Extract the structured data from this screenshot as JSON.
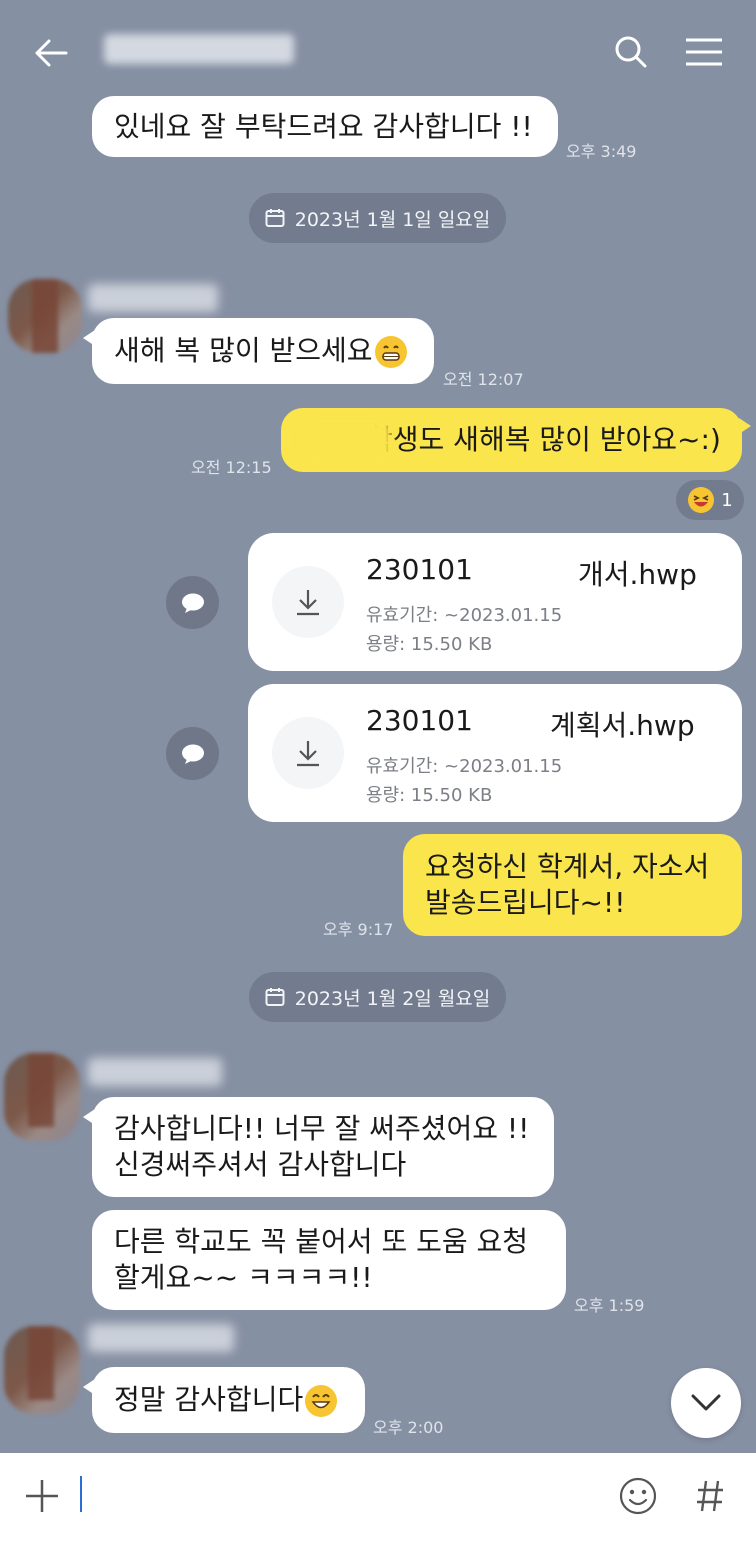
{
  "header": {
    "title": "",
    "back_icon": "arrow-left-icon",
    "search_icon": "search-icon",
    "menu_icon": "menu-icon"
  },
  "messages": {
    "m1": {
      "text": "있네요 잘 부탁드려요 감사합니다 !!",
      "time": "오후 3:49"
    },
    "date1": "2023년 1월 1일 일요일",
    "m2": {
      "sender": "",
      "text": "새해 복 많이 받으세요",
      "time": "오전 12:07"
    },
    "m3": {
      "text": "학생도 새해복 많이 받아요~:)",
      "time": "오전 12:15"
    },
    "reaction": {
      "count": "1"
    },
    "file1": {
      "name": "230101",
      "name_end": "개서.hwp",
      "expiry_label": "유효기간: ",
      "expiry": "~2023.01.15",
      "size_label": "용량: ",
      "size": "15.50 KB"
    },
    "file2": {
      "name": "230101",
      "name_end": "계획서.hwp",
      "expiry_label": "유효기간: ",
      "expiry": "~2023.01.15",
      "size_label": "용량: ",
      "size": "15.50 KB"
    },
    "m4": {
      "line1": "요청하신 학계서, 자소서",
      "line2": "발송드립니다~!!",
      "time": "오후 9:17"
    },
    "date2": "2023년 1월 2일 월요일",
    "m5": {
      "line1": "감사합니다!! 너무 잘 써주셨어요 !!",
      "line2": "신경써주셔서 감사합니다"
    },
    "m6": {
      "line1": "다른 학교도 꼭 붙어서 또 도움 요청",
      "line2": "할게요~~ ㅋㅋㅋㅋ!!",
      "time": "오후 1:59"
    },
    "m7": {
      "text": "정말 감사합니다",
      "time": "오후 2:00"
    }
  },
  "input": {
    "placeholder": ""
  },
  "colors": {
    "background": "#8690a3",
    "my_bubble": "#fbe54c",
    "other_bubble": "#ffffff",
    "date_chip": "#737c8e"
  }
}
